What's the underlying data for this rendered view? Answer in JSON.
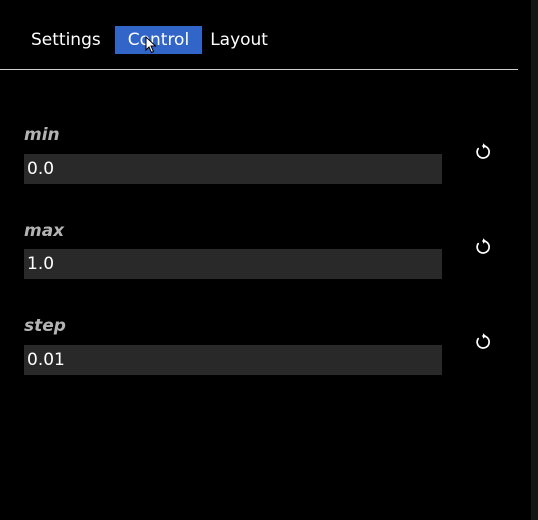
{
  "tabs": [
    {
      "label": "Settings",
      "active": false
    },
    {
      "label": "Control",
      "active": true
    },
    {
      "label": "Layout",
      "active": false
    }
  ],
  "fields": [
    {
      "label": "min",
      "value": "0.0",
      "reset_icon": "reset-icon"
    },
    {
      "label": "max",
      "value": "1.0",
      "reset_icon": "reset-icon"
    },
    {
      "label": "step",
      "value": "0.01",
      "reset_icon": "reset-icon"
    }
  ],
  "colors": {
    "background": "#000000",
    "active_tab": "#3166c8",
    "input_background": "#292929",
    "label": "#b3b3b3"
  }
}
